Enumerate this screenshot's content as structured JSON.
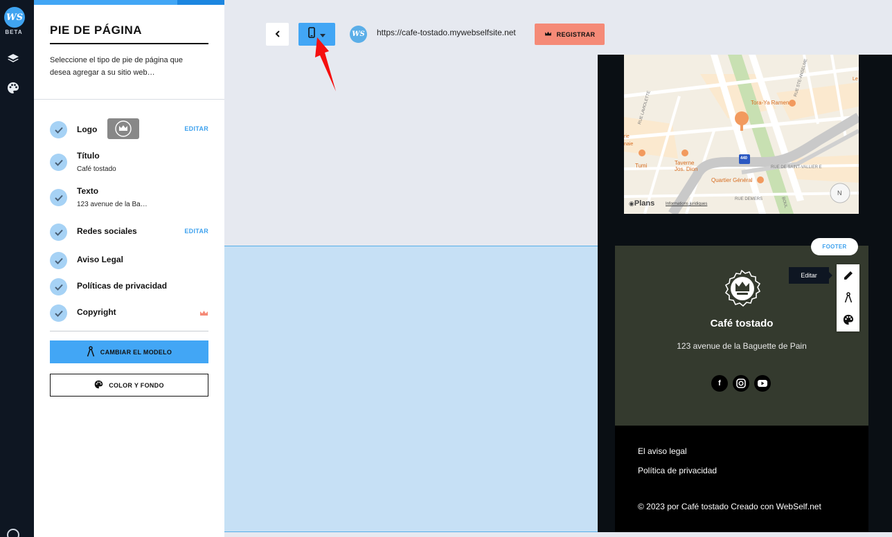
{
  "rail": {
    "logo_text": "WS",
    "beta_label": "BETA",
    "icons": [
      "layers-icon",
      "palette-icon",
      "help-icon"
    ]
  },
  "panel": {
    "title": "PIE DE PÁGINA",
    "description": "Seleccione el tipo de pie de página que desea agregar a su sitio web…",
    "options": [
      {
        "label": "Logo",
        "action": "EDITAR"
      },
      {
        "label": "Título",
        "value": "Café tostado"
      },
      {
        "label": "Texto",
        "value": "123 avenue de la Ba…"
      },
      {
        "label": "Redes sociales",
        "action": "EDITAR"
      },
      {
        "label": "Aviso Legal"
      },
      {
        "label": "Políticas de privacidad"
      },
      {
        "label": "Copyright",
        "premium": true
      }
    ],
    "change_model_label": "CAMBIAR EL MODELO",
    "color_bg_label": "COLOR Y FONDO"
  },
  "toolbar": {
    "url": "https://cafe-tostado.mywebselfsite.net",
    "register_label": "REGISTRAR",
    "ws_logo_text": "WS"
  },
  "map": {
    "labels": [
      "Tora-Ya Ramen",
      "Taverne Jos. Dion",
      "Quartier Général",
      "Tumi",
      "RUE LAVIOLETTE",
      "RUE STE-ANSELME",
      "RUE DE SAINT-VALLIER E",
      "RUE DEMERS",
      "BOUL",
      "Plans",
      "Informations juridiques",
      "N",
      "440",
      "Le",
      "rie",
      "naie"
    ]
  },
  "preview": {
    "footer_tag": "FOOTER",
    "tooltip": "Editar",
    "site_title": "Café tostado",
    "address": "123 avenue de la Baguette de Pain",
    "social": [
      "f",
      "ig",
      "yt"
    ],
    "legal_link": "El aviso legal",
    "privacy_link": "Política de privacidad",
    "copyright": "© 2023 por Café tostado Creado con WebSelf.net"
  },
  "colors": {
    "accent": "#42a6f5",
    "register": "#f58a77",
    "footer_bg": "#343a2e",
    "rail_bg": "#0e1622"
  }
}
